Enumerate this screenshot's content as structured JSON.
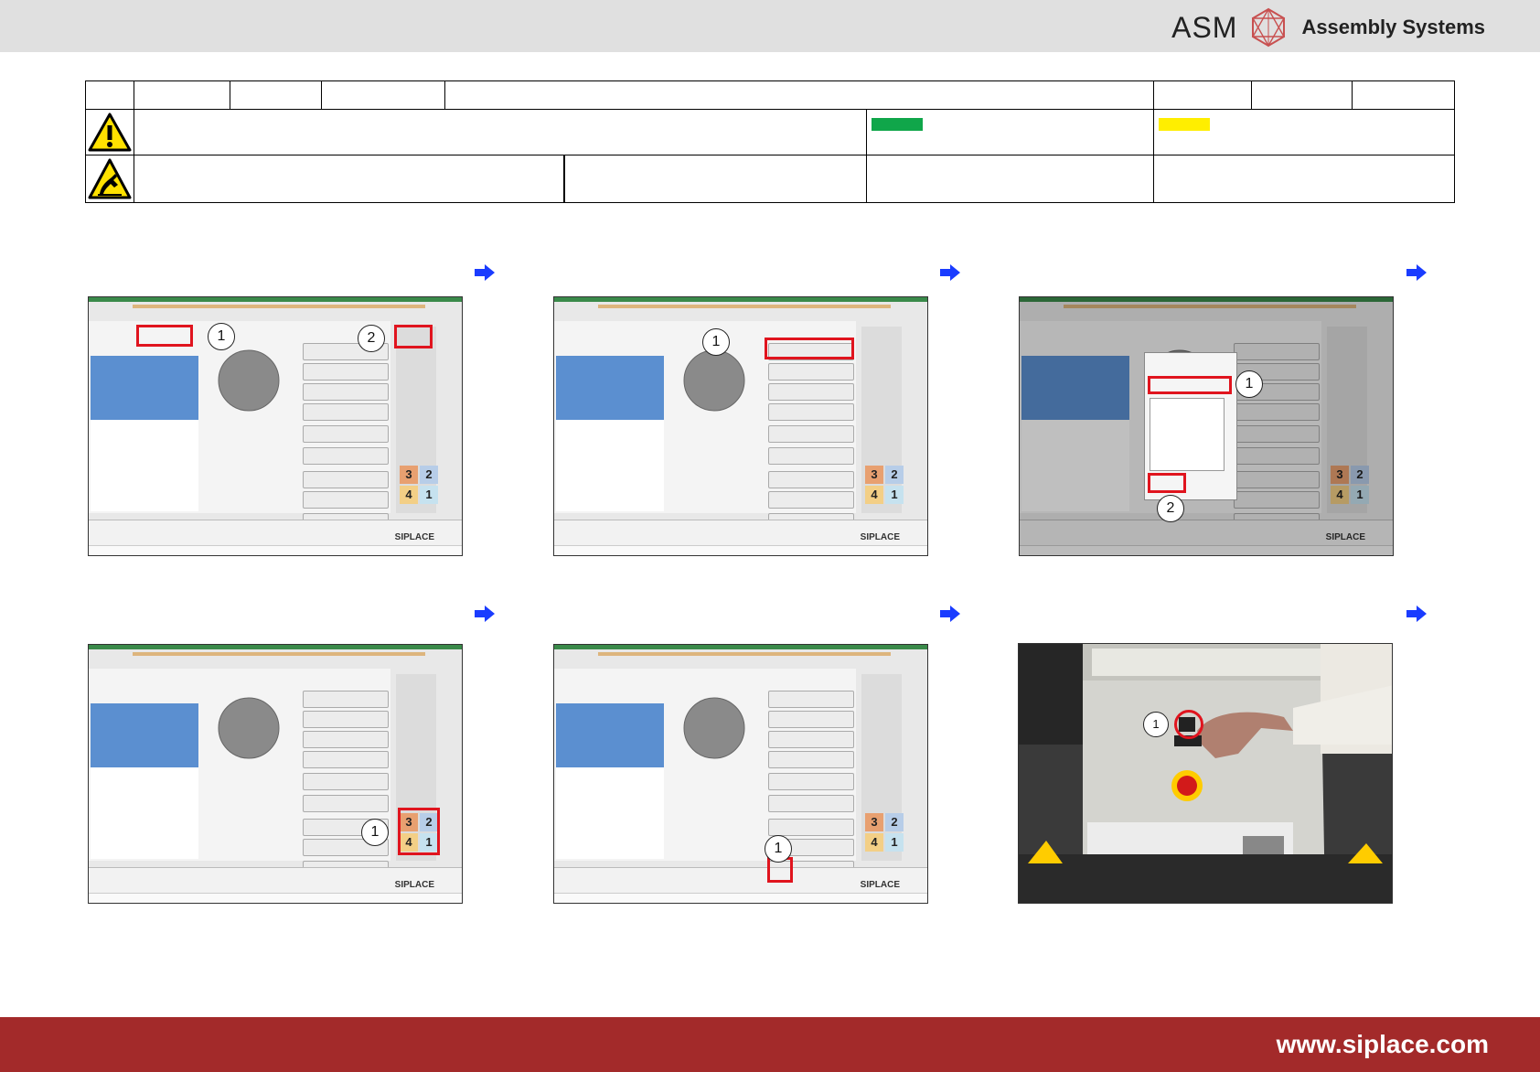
{
  "header": {
    "brand": "ASM",
    "tagline": "Assembly Systems"
  },
  "colors": {
    "green_marker": "#10a64a",
    "yellow_marker": "#ffee00",
    "accent_red": "#e0141e",
    "arrow_blue": "#1a3cff",
    "footer_bg": "#a32a2a"
  },
  "panels": [
    {
      "callouts": [
        "1",
        "2"
      ],
      "siplace": "SIPLACE"
    },
    {
      "callouts": [
        "1"
      ],
      "siplace": "SIPLACE"
    },
    {
      "callouts": [
        "1",
        "2"
      ],
      "siplace": "SIPLACE"
    },
    {
      "callouts": [
        "1"
      ],
      "siplace": "SIPLACE"
    },
    {
      "callouts": [
        "1"
      ],
      "siplace": "SIPLACE"
    },
    {
      "callouts": [
        "1"
      ]
    }
  ],
  "tiles": [
    "3",
    "2",
    "4",
    "1"
  ],
  "footer": {
    "url": "www.siplace.com"
  }
}
